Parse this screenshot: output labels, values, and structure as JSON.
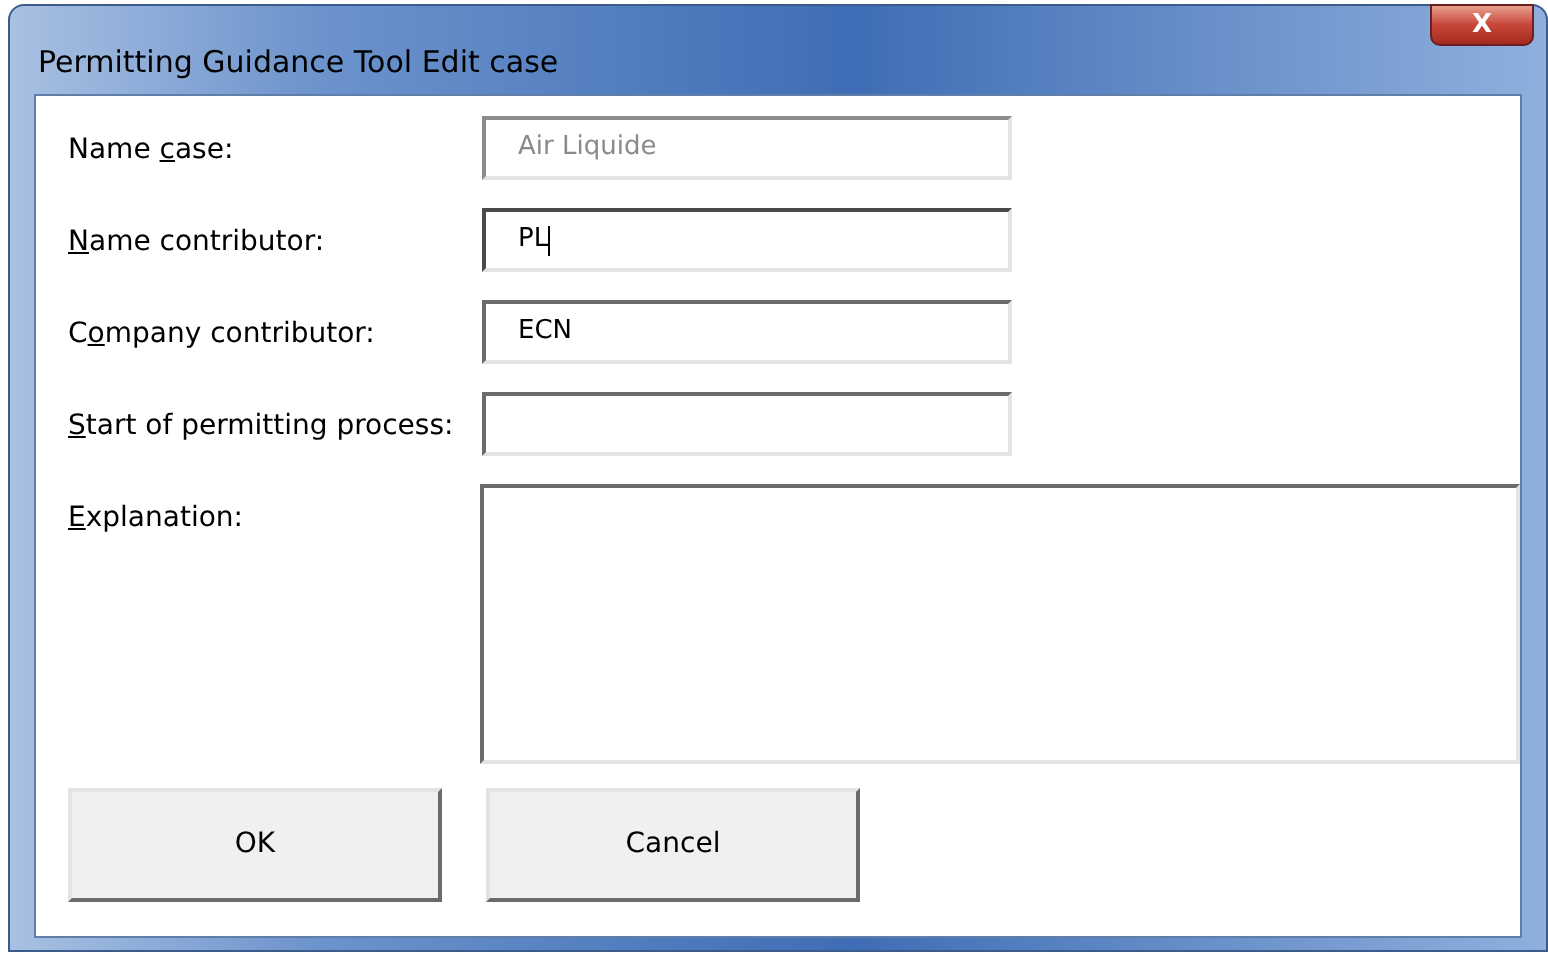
{
  "window": {
    "title": "Permitting Guidance Tool Edit case",
    "close": "X"
  },
  "fields": [
    {
      "kind": "text",
      "label": {
        "before": "Name ",
        "key": "c",
        "after": "ase:"
      },
      "value": "Air Liquide",
      "disabled": true,
      "focused": false
    },
    {
      "kind": "text",
      "label": {
        "key": "N",
        "after": "ame contributor:"
      },
      "value": "PL",
      "disabled": false,
      "focused": true
    },
    {
      "kind": "text",
      "label": {
        "before": "C",
        "key": "o",
        "after": "mpany contributor:"
      },
      "value": "ECN",
      "disabled": false,
      "focused": false
    },
    {
      "kind": "text",
      "label": {
        "key": "S",
        "after": "tart of permitting process:"
      },
      "disabled": false,
      "focused": false
    },
    {
      "kind": "multiline",
      "label": {
        "key": "E",
        "after": "xplanation:"
      },
      "disabled": false,
      "focused": false
    }
  ],
  "buttons": [
    "OK",
    "Cancel"
  ]
}
